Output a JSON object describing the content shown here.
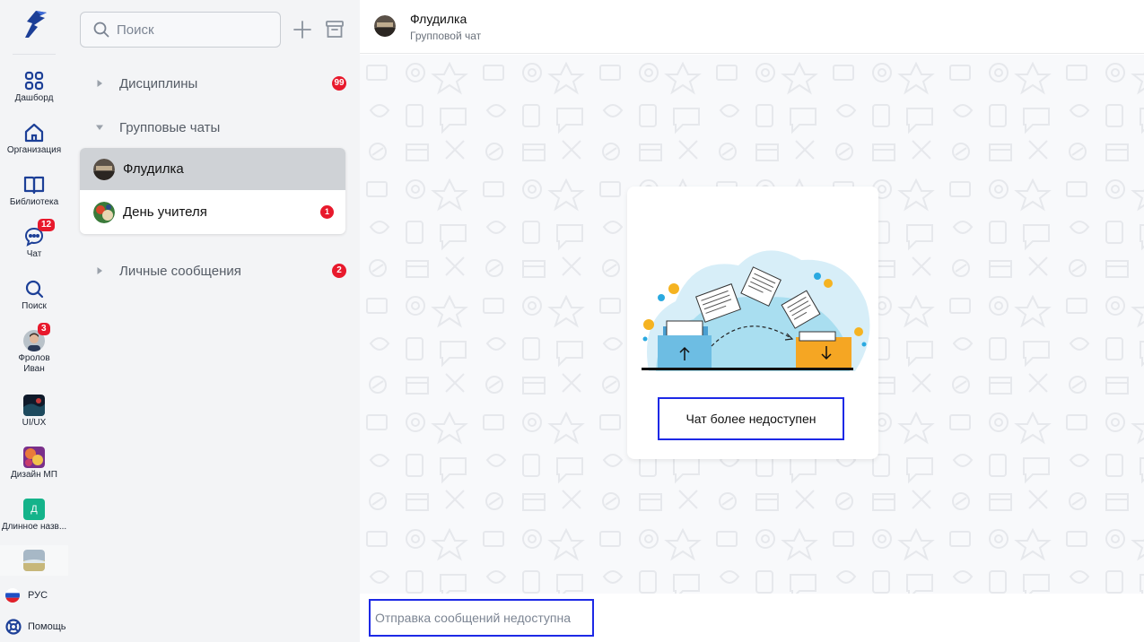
{
  "rail": {
    "items": [
      {
        "label": "Дашборд",
        "icon": "dashboard-grid-icon"
      },
      {
        "label": "Организация",
        "icon": "home-icon"
      },
      {
        "label": "Библиотека",
        "icon": "book-icon"
      },
      {
        "label": "Чат",
        "icon": "chat-bubble-icon",
        "badge": "12"
      },
      {
        "label": "Поиск",
        "icon": "search-icon"
      },
      {
        "label": "Фролов Иван",
        "icon": "user-avatar",
        "badge": "3"
      },
      {
        "label": "UI/UX",
        "icon": "workspace-thumbnail"
      },
      {
        "label": "Дизайн МП",
        "icon": "workspace-thumbnail"
      },
      {
        "label": "Длинное назв...",
        "icon": "workspace-letter",
        "letter": "Д"
      }
    ],
    "language": "РУС",
    "help": "Помощь"
  },
  "panel": {
    "search_placeholder": "Поиск",
    "sections": [
      {
        "title": "Дисциплины",
        "badge": "99",
        "expanded": false
      },
      {
        "title": "Групповые чаты",
        "expanded": true
      },
      {
        "title": "Личные сообщения",
        "badge": "2",
        "expanded": false
      }
    ],
    "group_chats": [
      {
        "name": "Флудилка",
        "active": true
      },
      {
        "name": "День учителя",
        "badge": "1"
      }
    ]
  },
  "chat": {
    "title": "Флудилка",
    "subtitle": "Групповой чат",
    "unavailable_label": "Чат более недоступен",
    "composer_placeholder": "Отправка сообщений недоступна"
  },
  "colors": {
    "accent_border": "#1d29e6",
    "badge": "#e8192c",
    "rail_bg": "#f3f4f6",
    "active_row": "#cfd2d6"
  }
}
